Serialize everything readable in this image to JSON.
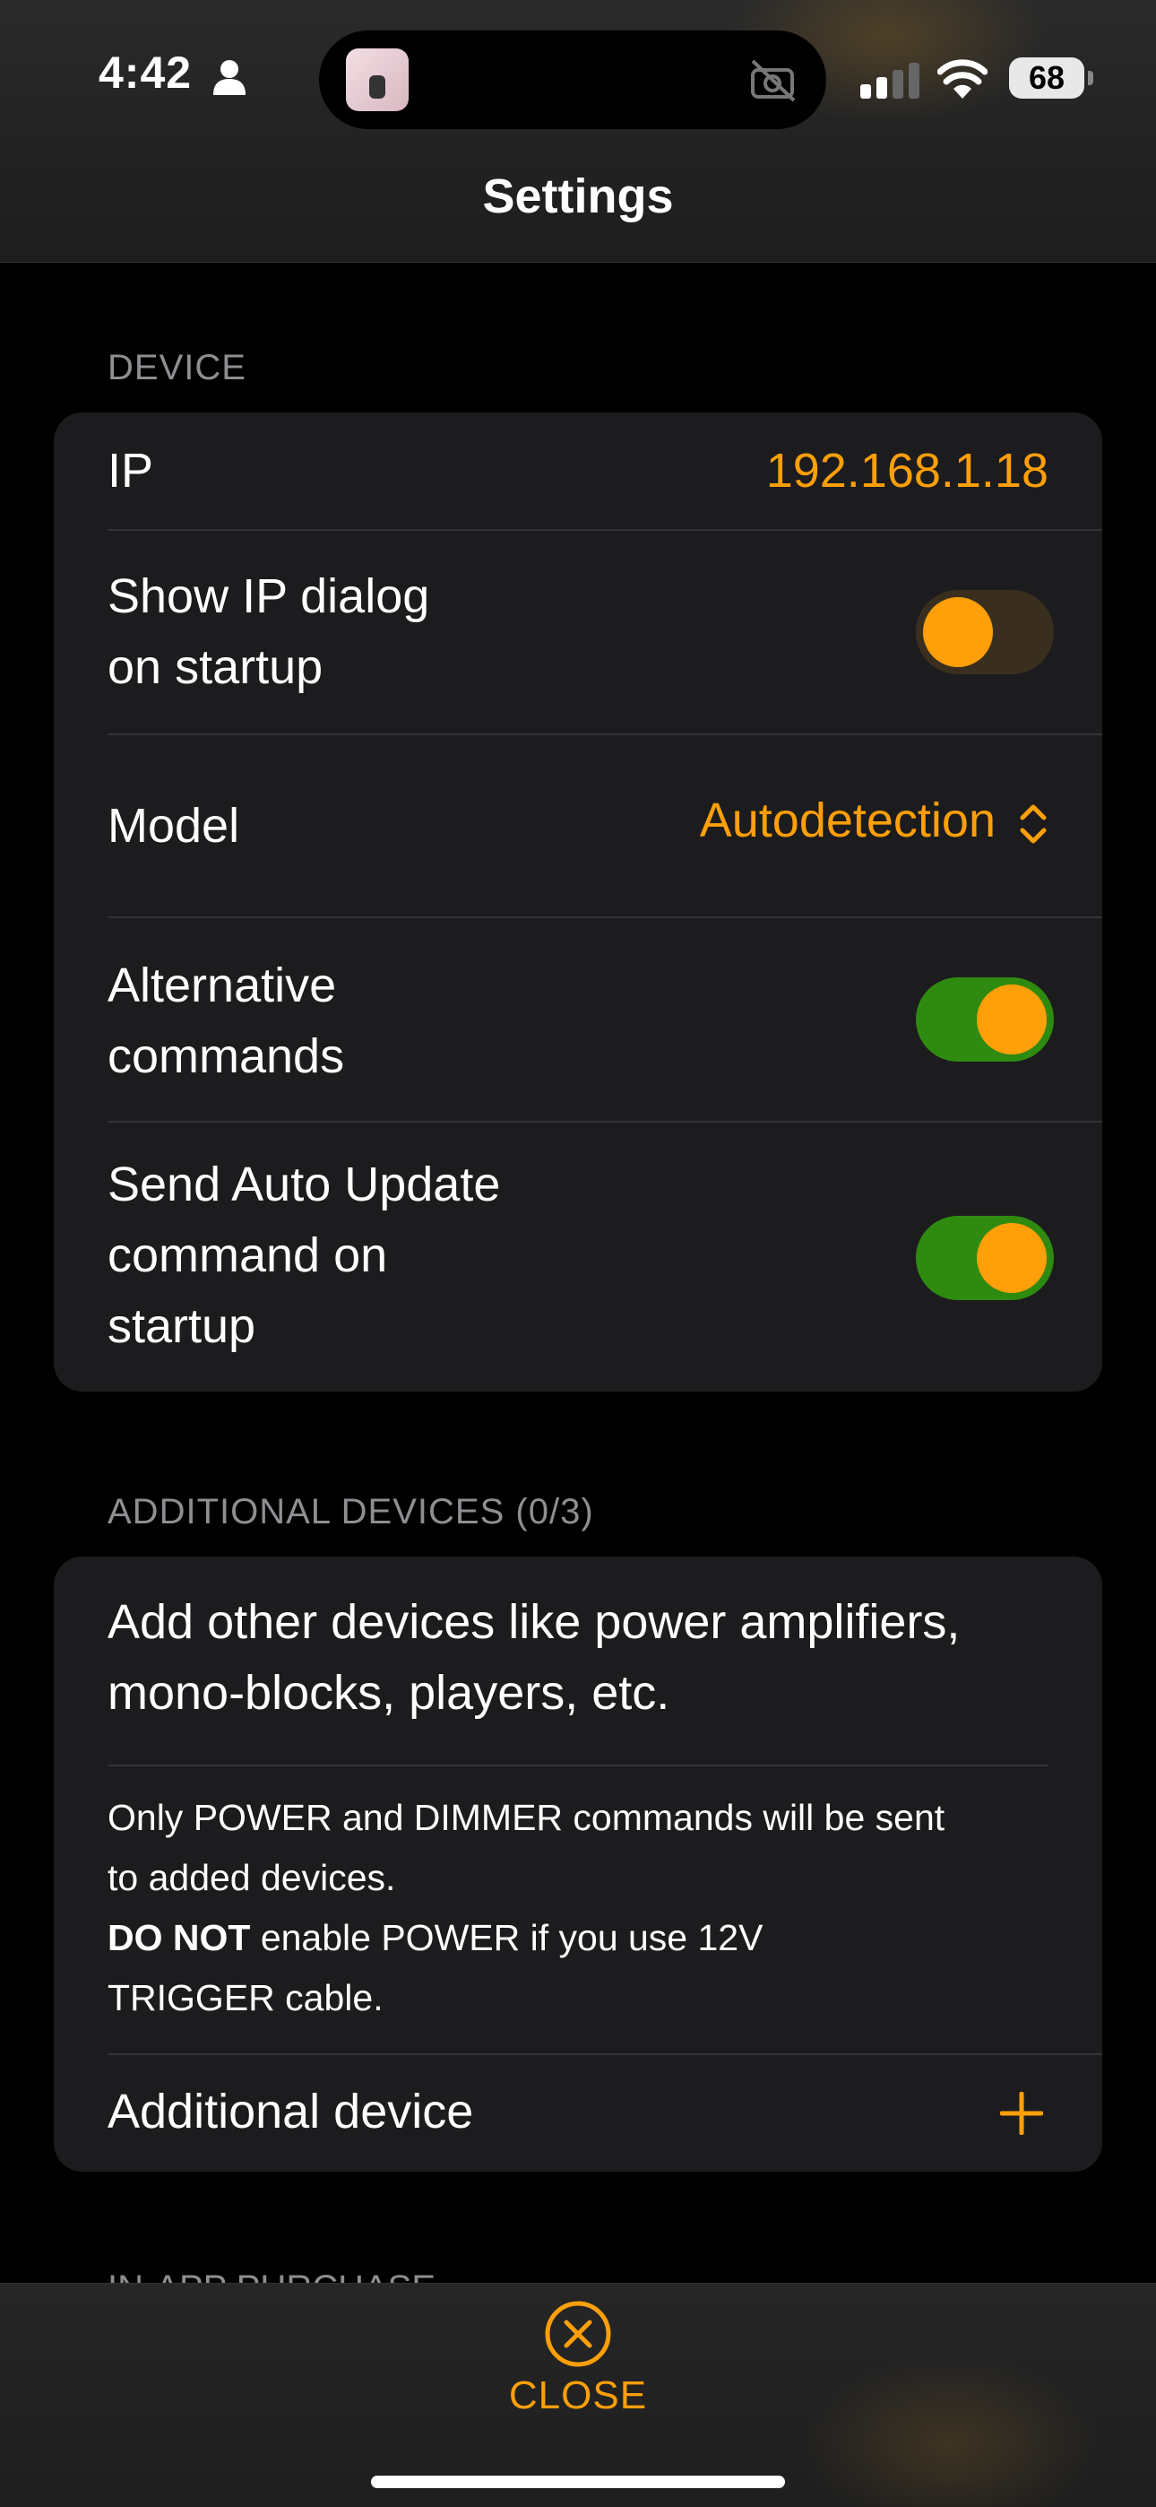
{
  "status_bar": {
    "time": "4:42",
    "battery": "68"
  },
  "nav": {
    "title": "Settings"
  },
  "device_section": {
    "header": "DEVICE",
    "ip": {
      "label": "IP",
      "value": "192.168.1.18"
    },
    "show_ip_dialog": {
      "label_line1": "Show IP dialog",
      "label_line2": "on startup",
      "enabled": false
    },
    "model": {
      "label": "Model",
      "value": "Autodetection"
    },
    "alternative_commands": {
      "label_line1": "Alternative",
      "label_line2": "commands",
      "enabled": true
    },
    "send_auto_update": {
      "label_line1": "Send Auto Update",
      "label_line2": "command on",
      "label_line3": "startup",
      "enabled": true
    }
  },
  "additional_section": {
    "header": "ADDITIONAL DEVICES (0/3)",
    "intro_line1": "Add other devices like power amplifiers,",
    "intro_line2": "mono-blocks, players, etc.",
    "note_line1": "Only POWER and DIMMER commands will be sent",
    "note_line2": "to added devices.",
    "warning_bold": "DO NOT",
    "warning_rest": " enable POWER if you use 12V",
    "warning_line2": "TRIGGER cable.",
    "add_row_label": "Additional device"
  },
  "peek_section": {
    "header": "IN-APP PURCHASE"
  },
  "bottom_bar": {
    "close_label": "CLOSE"
  },
  "colors": {
    "accent": "#ff9f0a",
    "toggle_on": "#2f8a10",
    "card_bg": "#1c1c1e"
  }
}
